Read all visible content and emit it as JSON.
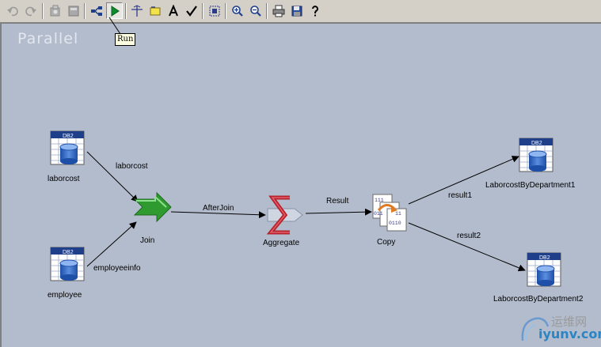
{
  "toolbar": {
    "tooltip": "Run"
  },
  "canvas": {
    "title": "Parallel"
  },
  "stages": {
    "laborcost_source": {
      "label": "laborcost",
      "badge": "DB2"
    },
    "employee_source": {
      "label": "employee",
      "badge": "DB2"
    },
    "join": {
      "label": "Join"
    },
    "aggregate": {
      "label": "Aggregate"
    },
    "copy": {
      "label": "Copy"
    },
    "target1": {
      "label": "LaborcostByDepartment1",
      "badge": "DB2"
    },
    "target2": {
      "label": "LaborcostByDepartment2",
      "badge": "DB2"
    }
  },
  "links": {
    "laborcost": "laborcost",
    "employeeinfo": "employeeinfo",
    "afterjoin": "AfterJoin",
    "result": "Result",
    "result1": "result1",
    "result2": "result2"
  },
  "copy_icon_bits": {
    "top": "111",
    "left": "011",
    "right": "11",
    "bottom": "0110"
  },
  "watermark": {
    "line1": "运维网",
    "line2": "iyunv.com"
  },
  "colors": {
    "canvas_bg": "#b3bccd",
    "toolbar_bg": "#d4d0c8",
    "db2_header": "#1f3f8a",
    "join_arrow": "#2f9a2f",
    "aggregate_sigma": "#b8202a"
  }
}
